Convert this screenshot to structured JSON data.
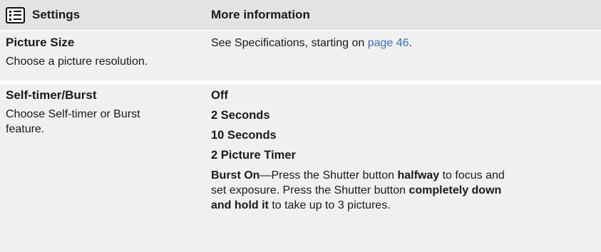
{
  "header": {
    "settings_label": "Settings",
    "more_info_label": "More information"
  },
  "rows": [
    {
      "title": "Picture Size",
      "desc": "Choose a picture resolution.",
      "info_prefix": "See Specifications, starting on ",
      "info_link": "page 46",
      "info_suffix": "."
    },
    {
      "title": "Self-timer/Burst",
      "desc_line1": "Choose Self-timer or Burst",
      "desc_line2": "feature.",
      "options": [
        "Off",
        "2 Seconds",
        "10 Seconds",
        "2 Picture Timer"
      ],
      "burst": {
        "label": "Burst On",
        "dash": "—Press the Shutter button ",
        "bold1": "halfway",
        "text1": " to focus and",
        "text2": "set exposure. Press the Shutter button ",
        "bold2a": "completely down",
        "bold2b": "and hold it",
        "text3": " to take up to 3 pictures."
      }
    }
  ],
  "icons": {
    "settings": "list-menu-icon"
  }
}
